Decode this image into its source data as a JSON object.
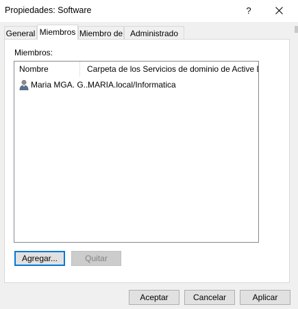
{
  "window": {
    "title": "Propiedades: Software",
    "help": "?"
  },
  "tabs": [
    {
      "label": "General"
    },
    {
      "label": "Miembros",
      "active": true
    },
    {
      "label": "Miembro de"
    },
    {
      "label": "Administrado por"
    }
  ],
  "members": {
    "label": "Miembros:",
    "columns": [
      {
        "label": "Nombre"
      },
      {
        "label": "Carpeta de los Servicios de dominio de Active Dir..."
      }
    ],
    "rows": [
      {
        "name": "Maria MGA. G...",
        "folder": "MARIA.local/Informatica",
        "icon": "user-icon"
      }
    ],
    "add_label": "Agregar...",
    "remove_label": "Quitar"
  },
  "footer": {
    "ok_label": "Aceptar",
    "cancel_label": "Cancelar",
    "apply_label": "Aplicar"
  }
}
